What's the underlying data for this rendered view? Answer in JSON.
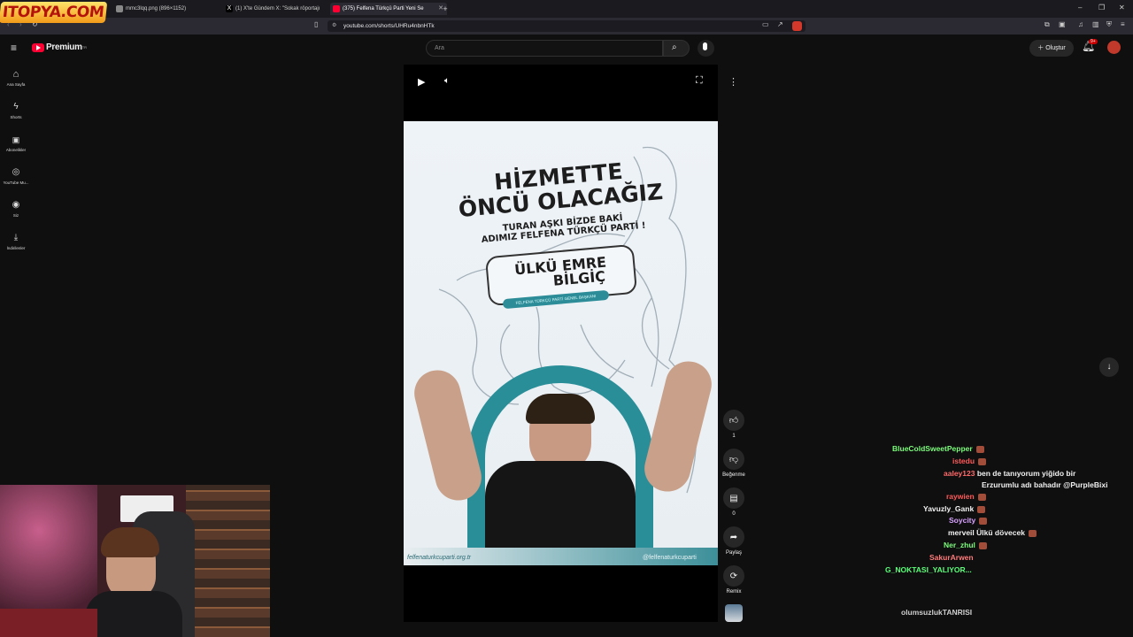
{
  "logo_text": "ITOPYA.COM",
  "tabs": [
    {
      "title": "mmc3lqq.png (896×1152)"
    },
    {
      "title": "(1) X'te Gündem X: \"Sokak röportajı"
    },
    {
      "title": "(375) Felfena Türkçü Parti Yeni Se"
    }
  ],
  "new_tab": "+",
  "url": "youtube.com/shorts/UHRu4nbnHTk",
  "youtube": {
    "brand": "Premium",
    "brand_sup": "TR",
    "search_placeholder": "Ara",
    "create_label": "Oluştur",
    "notif_count": "9+"
  },
  "sidebar": [
    {
      "label": "Ana Sayfa",
      "icon": "home-icon"
    },
    {
      "label": "Shorts",
      "icon": "shorts-icon"
    },
    {
      "label": "Abonelikler",
      "icon": "subscriptions-icon"
    },
    {
      "label": "YouTube Mu...",
      "icon": "youtube-music-icon"
    },
    {
      "label": "Siz",
      "icon": "you-icon"
    },
    {
      "label": "İndirilenler",
      "icon": "download-icon"
    }
  ],
  "video": {
    "headline_1": "HİZMETTE",
    "headline_2": "ÖNCÜ OLACAĞIZ",
    "sub_1": "TURAN AŞKI BİZDE BAKİ",
    "sub_2": "ADIMIZ FELFENA TÜRKÇÜ PARTİ !",
    "name_1": "ÜLKÜ EMRE",
    "name_2": "BİLGİÇ",
    "role": "FELFENA TÜRKÇÜ PARTİ GENEL BAŞKANI",
    "website": "felfenaturkcuparti.org.tr",
    "handle": "@felfenaturkcuparti"
  },
  "actions": {
    "like_count": "1",
    "dislike_label": "Beğenme",
    "comment_count": "0",
    "share_label": "Paylaş",
    "remix_label": "Remix"
  },
  "chat": [
    {
      "user": "BlueColdSweetPepper",
      "msg": "",
      "color": "#7cfc7c"
    },
    {
      "user": "istedu",
      "msg": "",
      "color": "#ff5a5a"
    },
    {
      "user": "aaley123",
      "msg": "ben de tanıyorum yiğido bir",
      "color": "#ff6a6a"
    },
    {
      "user": "",
      "msg": "Erzurumlu adı bahadır @PurpleBixi",
      "color": "#ffffff"
    },
    {
      "user": "raywien",
      "msg": "",
      "color": "#ff5a5a"
    },
    {
      "user": "Yavuzly_Gank",
      "msg": "",
      "color": "#f3f3f3"
    },
    {
      "user": "Soycity",
      "msg": "",
      "color": "#d9a2ff"
    },
    {
      "user": "merveil",
      "msg": "Ülkü dövecek",
      "color": "#f3f3f3"
    },
    {
      "user": "Ner_zhul",
      "msg": "",
      "color": "#7cfc7c"
    },
    {
      "user": "SakurArwen",
      "msg": "",
      "color": "#ff7b7b"
    },
    {
      "user": "G_NOKTASI_YALIYOR...",
      "msg": "",
      "color": "#5cff7a"
    },
    {
      "user": "olumsuzlukTANRISI",
      "msg": "",
      "color": "#cfcfcf"
    }
  ]
}
